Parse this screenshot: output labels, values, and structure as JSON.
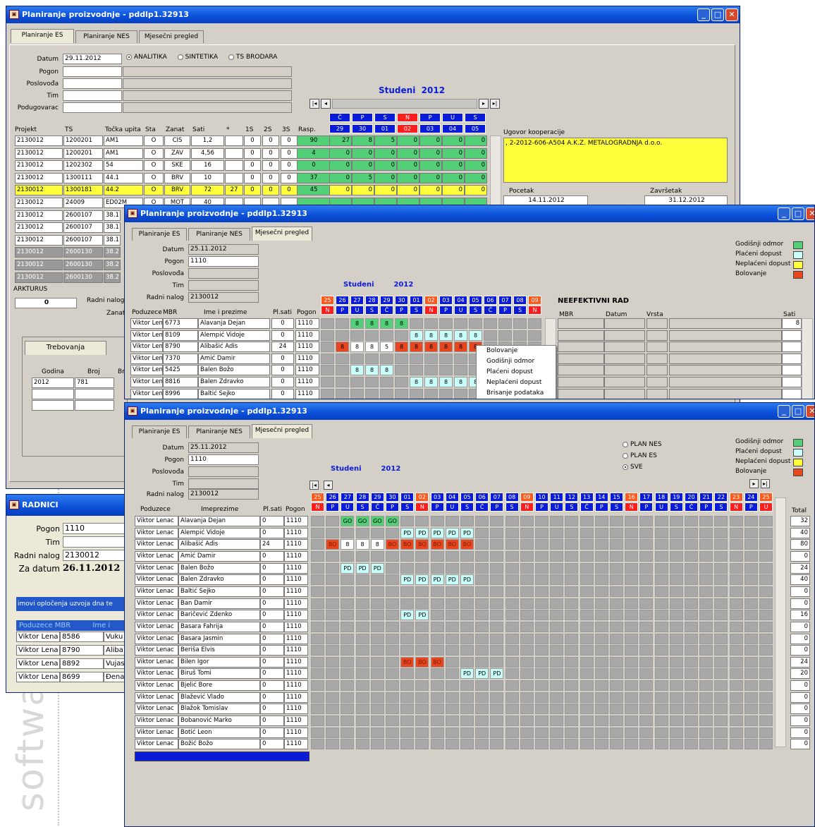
{
  "watermark": "softwa",
  "colors": {
    "title_blue": "#0a4fd6",
    "green": "#53cf78",
    "yellow": "#ffff3c",
    "red_bo": "#e8461f",
    "cyan_pd": "#c8fffb",
    "header_blue": "#0a1cd8",
    "header_red": "#ff1e1e",
    "header_orange": "#ff5a1e"
  },
  "win1": {
    "title": "Planiranje proizvodnje - pddlp1.32913",
    "tabs": [
      "Planiranje ES",
      "Planiranje NES",
      "Mjesečni pregled"
    ],
    "labels": {
      "datum": "Datum",
      "pogon": "Pogon",
      "poslovoda": "Poslovođa",
      "tim": "Tim",
      "podugovarac": "Podugovarac"
    },
    "datum_value": "29.11.2012",
    "radio": [
      "ANALITIKA",
      "SINTETIKA",
      "TS BRODARA"
    ],
    "month_title": "Studeni",
    "year": "2012",
    "day_letters": [
      "Č",
      "P",
      "S",
      "N",
      "P",
      "U",
      "S"
    ],
    "day_numbers": [
      "29",
      "30",
      "01",
      "02",
      "03",
      "04",
      "05"
    ],
    "col_headers": [
      "Projekt",
      "TS",
      "Točka upita",
      "Sta",
      "Zanat",
      "Sati",
      "*",
      "1S",
      "2S",
      "3S",
      "Rasp."
    ],
    "rows": [
      {
        "p": "2130012",
        "ts": "1200201",
        "tu": "AM1",
        "sta": "O",
        "z": "CIS",
        "s": "1,2",
        "st": "",
        "a": "0",
        "b": "0",
        "c": "0",
        "r": "90",
        "d": [
          "27",
          "8",
          "5",
          "0",
          "0",
          "0",
          "0"
        ]
      },
      {
        "p": "2130012",
        "ts": "1200201",
        "tu": "AM1",
        "sta": "O",
        "z": "ZAV",
        "s": "4,56",
        "st": "",
        "a": "0",
        "b": "0",
        "c": "0",
        "r": "4",
        "d": [
          "0",
          "0",
          "0",
          "0",
          "0",
          "0",
          "0"
        ]
      },
      {
        "p": "2130012",
        "ts": "1202302",
        "tu": "54",
        "sta": "O",
        "z": "SKE",
        "s": "16",
        "st": "",
        "a": "0",
        "b": "0",
        "c": "0",
        "r": "0",
        "d": [
          "0",
          "0",
          "0",
          "0",
          "0",
          "0",
          "0"
        ]
      },
      {
        "p": "2130012",
        "ts": "1300111",
        "tu": "44.1",
        "sta": "O",
        "z": "BRV",
        "s": "10",
        "st": "",
        "a": "0",
        "b": "0",
        "c": "0",
        "r": "37",
        "d": [
          "0",
          "5",
          "0",
          "0",
          "0",
          "0",
          "0"
        ]
      },
      {
        "p": "2130012",
        "ts": "1300181",
        "tu": "44.2",
        "sta": "O",
        "z": "BRV",
        "s": "72",
        "st": "27",
        "a": "0",
        "b": "0",
        "c": "0",
        "r": "45",
        "d": [
          "0",
          "0",
          "0",
          "0",
          "0",
          "0",
          "0"
        ]
      },
      {
        "p": "2130012",
        "ts": "24009",
        "tu": "ED02M",
        "sta": "O",
        "z": "MOT",
        "s": "40",
        "st": "",
        "a": "",
        "b": "",
        "c": "",
        "r": "",
        "d": [
          "",
          "",
          "",
          "",
          "",
          "",
          ""
        ]
      },
      {
        "p": "2130012",
        "ts": "2600107",
        "tu": "38.1",
        "sta": "",
        "z": "",
        "s": "",
        "st": "",
        "a": "",
        "b": "",
        "c": "",
        "r": "",
        "d": []
      },
      {
        "p": "2130012",
        "ts": "2600107",
        "tu": "38.1",
        "sta": "",
        "z": "",
        "s": "",
        "st": "",
        "a": "",
        "b": "",
        "c": "",
        "r": "",
        "d": []
      },
      {
        "p": "2130012",
        "ts": "2600107",
        "tu": "38.1",
        "sta": "",
        "z": "",
        "s": "",
        "st": "",
        "a": "",
        "b": "",
        "c": "",
        "r": "",
        "d": []
      },
      {
        "p": "2130012",
        "ts": "2600130",
        "tu": "38.2",
        "sta": "",
        "z": "",
        "s": "",
        "st": "",
        "a": "",
        "b": "",
        "c": "",
        "r": "",
        "d": []
      },
      {
        "p": "2130012",
        "ts": "2600130",
        "tu": "38.2",
        "sta": "",
        "z": "",
        "s": "",
        "st": "",
        "a": "",
        "b": "",
        "c": "",
        "r": "",
        "d": []
      },
      {
        "p": "2130012",
        "ts": "2600130",
        "tu": "38.2",
        "sta": "",
        "z": "",
        "s": "",
        "st": "",
        "a": "",
        "b": "",
        "c": "",
        "r": "",
        "d": []
      }
    ],
    "ugovor_label": "Ugovor kooperacije",
    "ugovor_text": ", 2-2012-606-A504 A.K.Z. METALOGRADNJA d.o.o.",
    "pocetak_label": "Pocetak",
    "pocetak": "14.11.2012",
    "zavrsetak_label": "Završetak",
    "zavrsetak": "31.12.2012",
    "arkturus": "ARKTURUS",
    "arkturus_val": "0",
    "radni_nalog": "Radni nalog",
    "zanat": "Zanat",
    "trebovanja": "Trebovanja",
    "godina": "Godina",
    "broj": "Broj",
    "br": "Br",
    "godina_val": "2012",
    "broj_val": "781"
  },
  "radnici": {
    "title": "RADNICI",
    "pogon_label": "Pogon",
    "pogon": "1110",
    "tim_label": "Tim",
    "radni_label": "Radni nalog",
    "radni": "2130012",
    "za_label": "Za datum",
    "za": "26.11.2012",
    "banner": "imovi opločenja uzvoja dna te",
    "headers": [
      "Poduzece",
      "MBR",
      "Ime i"
    ],
    "rows": [
      [
        "Viktor Lena",
        "8586",
        "Vuku"
      ],
      [
        "Viktor Lena",
        "8790",
        "Aliba"
      ],
      [
        "Viktor Lena",
        "8892",
        "Vujas"
      ],
      [
        "Viktor Lena",
        "8699",
        "Đena"
      ]
    ]
  },
  "win2": {
    "title": "Planiranje proizvodnje - pddlp1.32913",
    "tabs": [
      "Planiranje ES",
      "Planiranje NES",
      "Mjesečni pregled"
    ],
    "datum_label": "Datum",
    "datum": "25.11.2012",
    "pogon_label": "Pogon",
    "pogon": "1110",
    "poslovoda_label": "Poslovođa",
    "tim_label": "Tim",
    "radni_label": "Radni nalog",
    "radni": "2130012",
    "month": "Studeni",
    "year": "2012",
    "legend": [
      {
        "label": "Godišnji odmor",
        "color": "#53cf78"
      },
      {
        "label": "Plaćeni dopust",
        "color": "#c8fffb"
      },
      {
        "label": "Neplaćeni dopust",
        "color": "#ffff3c"
      },
      {
        "label": "Bolovanje",
        "color": "#e8461f"
      }
    ],
    "day_numbers": [
      "25",
      "26",
      "27",
      "28",
      "29",
      "30",
      "01",
      "02",
      "03",
      "04",
      "05",
      "06",
      "07",
      "08",
      "09"
    ],
    "day_letters": [
      "N",
      "P",
      "U",
      "S",
      "Č",
      "P",
      "S",
      "N",
      "P",
      "U",
      "S",
      "Č",
      "P",
      "S",
      "N"
    ],
    "headers": [
      "Poduzece",
      "MBR",
      "Ime i prezime",
      "Pl.sati",
      "Pogon"
    ],
    "rows": [
      {
        "pod": "Viktor Len",
        "mbr": "6773",
        "ime": "Alavanja Dejan",
        "pl": "0",
        "pog": "1110",
        "d": [
          "",
          "",
          "8",
          "8",
          "8",
          "8",
          "",
          "",
          "",
          "",
          "",
          "",
          "",
          "",
          ""
        ],
        "c": [
          "",
          "",
          "g",
          "g",
          "g",
          "g",
          "",
          "",
          "",
          "",
          "",
          "",
          "",
          "",
          ""
        ]
      },
      {
        "pod": "Viktor Len",
        "mbr": "8109",
        "ime": "Alempić Vidoje",
        "pl": "0",
        "pog": "1110",
        "d": [
          "",
          "",
          "",
          "",
          "",
          "",
          "8",
          "8",
          "8",
          "8",
          "8",
          "",
          "",
          "",
          ""
        ],
        "c": [
          "",
          "",
          "",
          "",
          "",
          "",
          "c",
          "c",
          "c",
          "c",
          "c",
          "",
          "",
          "",
          ""
        ]
      },
      {
        "pod": "Viktor Len",
        "mbr": "8790",
        "ime": "Alibašić Adis",
        "pl": "24",
        "pog": "1110",
        "d": [
          "",
          "8",
          "8",
          "8",
          "5",
          "8",
          "8",
          "8",
          "8",
          "8",
          "8",
          "",
          "",
          "",
          ""
        ],
        "c": [
          "",
          "r",
          "w",
          "w",
          "w",
          "r",
          "r",
          "r",
          "r",
          "r",
          "r",
          "",
          "",
          "",
          ""
        ]
      },
      {
        "pod": "Viktor Len",
        "mbr": "7370",
        "ime": "Amić Damir",
        "pl": "0",
        "pog": "1110",
        "d": [
          "",
          "",
          "",
          "",
          "",
          "",
          "",
          "",
          "",
          "",
          "",
          "",
          "",
          "",
          ""
        ],
        "c": [
          "",
          "",
          "",
          "",
          "",
          "",
          "",
          "",
          "",
          "",
          "",
          "",
          "",
          "",
          ""
        ]
      },
      {
        "pod": "Viktor Len",
        "mbr": "5425",
        "ime": "Balen Božo",
        "pl": "0",
        "pog": "1110",
        "d": [
          "",
          "",
          "8",
          "8",
          "8",
          "",
          "",
          "",
          "",
          "",
          "",
          "",
          "",
          "",
          ""
        ],
        "c": [
          "",
          "",
          "c",
          "c",
          "c",
          "",
          "",
          "",
          "",
          "",
          "",
          "",
          "",
          "",
          ""
        ]
      },
      {
        "pod": "Viktor Len",
        "mbr": "8816",
        "ime": "Balen Zdravko",
        "pl": "0",
        "pog": "1110",
        "d": [
          "",
          "",
          "",
          "",
          "",
          "",
          "8",
          "8",
          "8",
          "8",
          "8",
          "",
          "",
          "",
          ""
        ],
        "c": [
          "",
          "",
          "",
          "",
          "",
          "",
          "c",
          "c",
          "c",
          "c",
          "c",
          "",
          "",
          "",
          ""
        ]
      },
      {
        "pod": "Viktor Len",
        "mbr": "8996",
        "ime": "Baltić Sejko",
        "pl": "0",
        "pog": "1110",
        "d": [
          "",
          "",
          "",
          "",
          "",
          "",
          "",
          "",
          "",
          "",
          "",
          "",
          "",
          "",
          ""
        ],
        "c": [
          "",
          "",
          "",
          "",
          "",
          "",
          "",
          "",
          "",
          "",
          "",
          "",
          "",
          "",
          ""
        ]
      }
    ],
    "context_menu": [
      "Bolovanje",
      "Godišnji odmor",
      "Plaćeni dopust",
      "Neplaćeni dopust",
      "Brisanje podataka"
    ],
    "neef_title": "NEEFEKTIVNI RAD",
    "neef_headers": [
      "MBR",
      "Datum",
      "Vrsta",
      "Sati"
    ],
    "neef_first": "8"
  },
  "win3": {
    "title": "Planiranje proizvodnje - pddlp1.32913",
    "tabs": [
      "Planiranje ES",
      "Planiranje NES",
      "Mjesečni pregled"
    ],
    "datum_label": "Datum",
    "datum": "25.11.2012",
    "pogon_label": "Pogon",
    "pogon": "1110",
    "poslovoda_label": "Poslovođa",
    "tim_label": "Tim",
    "radni_label": "Radni nalog",
    "radni": "2130012",
    "month": "Studeni",
    "year": "2012",
    "plan_options": [
      "PLAN NES",
      "PLAN ES",
      "SVE"
    ],
    "legend": [
      {
        "label": "Godišnji odmor",
        "color": "#53cf78"
      },
      {
        "label": "Plaćeni dopust",
        "color": "#c8fffb"
      },
      {
        "label": "Neplaćeni dopust",
        "color": "#ffff3c"
      },
      {
        "label": "Bolovanje",
        "color": "#e8461f"
      }
    ],
    "day_numbers": [
      "25",
      "26",
      "27",
      "28",
      "29",
      "30",
      "01",
      "02",
      "03",
      "04",
      "05",
      "06",
      "07",
      "08",
      "09",
      "10",
      "11",
      "12",
      "13",
      "14",
      "15",
      "16",
      "17",
      "18",
      "19",
      "20",
      "21",
      "22",
      "23",
      "24",
      "25"
    ],
    "day_letters": [
      "N",
      "P",
      "U",
      "S",
      "Č",
      "P",
      "S",
      "N",
      "P",
      "U",
      "S",
      "Č",
      "P",
      "S",
      "N",
      "P",
      "U",
      "S",
      "Č",
      "P",
      "S",
      "N",
      "P",
      "U",
      "S",
      "Č",
      "P",
      "S",
      "N",
      "P",
      "U"
    ],
    "headers": [
      "Poduzece",
      "Imeprezime",
      "Pl.sati",
      "Pogon",
      "Total"
    ],
    "rows": [
      {
        "pod": "Viktor Lenac",
        "ime": "Alavanja Dejan",
        "pl": "0",
        "pog": "1110",
        "t": "32",
        "marks": [
          [
            2,
            "GO"
          ],
          [
            3,
            "GO"
          ],
          [
            4,
            "GO"
          ],
          [
            5,
            "GO"
          ]
        ]
      },
      {
        "pod": "Viktor Lenac",
        "ime": "Alempić Vidoje",
        "pl": "0",
        "pog": "1110",
        "t": "40",
        "marks": [
          [
            6,
            "PD"
          ],
          [
            7,
            "PD"
          ],
          [
            8,
            "PD"
          ],
          [
            9,
            "PD"
          ],
          [
            10,
            "PD"
          ]
        ]
      },
      {
        "pod": "Viktor Lenac",
        "ime": "Alibašić Adis",
        "pl": "24",
        "pog": "1110",
        "t": "80",
        "marks": [
          [
            1,
            "BO"
          ],
          [
            2,
            "8"
          ],
          [
            3,
            "8"
          ],
          [
            4,
            "8"
          ],
          [
            5,
            "BO"
          ],
          [
            6,
            "BO"
          ],
          [
            7,
            "BO"
          ],
          [
            8,
            "BO"
          ],
          [
            9,
            "BO"
          ],
          [
            10,
            "BO"
          ]
        ]
      },
      {
        "pod": "Viktor Lenac",
        "ime": "Amić Damir",
        "pl": "0",
        "pog": "1110",
        "t": "0",
        "marks": []
      },
      {
        "pod": "Viktor Lenac",
        "ime": "Balen Božo",
        "pl": "0",
        "pog": "1110",
        "t": "24",
        "marks": [
          [
            2,
            "PD"
          ],
          [
            3,
            "PD"
          ],
          [
            4,
            "PD"
          ]
        ]
      },
      {
        "pod": "Viktor Lenac",
        "ime": "Balen Zdravko",
        "pl": "0",
        "pog": "1110",
        "t": "40",
        "marks": [
          [
            6,
            "PD"
          ],
          [
            7,
            "PD"
          ],
          [
            8,
            "PD"
          ],
          [
            9,
            "PD"
          ],
          [
            10,
            "PD"
          ]
        ]
      },
      {
        "pod": "Viktor Lenac",
        "ime": "Baltić Sejko",
        "pl": "0",
        "pog": "1110",
        "t": "0",
        "marks": []
      },
      {
        "pod": "Viktor Lenac",
        "ime": "Ban Damir",
        "pl": "0",
        "pog": "1110",
        "t": "0",
        "marks": []
      },
      {
        "pod": "Viktor Lenac",
        "ime": "Baričević Zdenko",
        "pl": "0",
        "pog": "1110",
        "t": "16",
        "marks": [
          [
            6,
            "PD"
          ],
          [
            7,
            "PD"
          ]
        ]
      },
      {
        "pod": "Viktor Lenac",
        "ime": "Basara Fahrija",
        "pl": "0",
        "pog": "1110",
        "t": "0",
        "marks": []
      },
      {
        "pod": "Viktor Lenac",
        "ime": "Basara Jasmin",
        "pl": "0",
        "pog": "1110",
        "t": "0",
        "marks": []
      },
      {
        "pod": "Viktor Lenac",
        "ime": "Beriša Elvis",
        "pl": "0",
        "pog": "1110",
        "t": "0",
        "marks": []
      },
      {
        "pod": "Viktor Lenac",
        "ime": "Bilen Igor",
        "pl": "0",
        "pog": "1110",
        "t": "24",
        "marks": [
          [
            6,
            "BO"
          ],
          [
            7,
            "BO"
          ],
          [
            8,
            "BO"
          ]
        ]
      },
      {
        "pod": "Viktor Lenac",
        "ime": "Biruš Tomi",
        "pl": "0",
        "pog": "1110",
        "t": "20",
        "marks": [
          [
            10,
            "PD"
          ],
          [
            11,
            "PD"
          ],
          [
            12,
            "PD"
          ]
        ]
      },
      {
        "pod": "Viktor Lenac",
        "ime": "Bjelić Bore",
        "pl": "0",
        "pog": "1110",
        "t": "0",
        "marks": []
      },
      {
        "pod": "Viktor Lenac",
        "ime": "Blažević Vlado",
        "pl": "0",
        "pog": "1110",
        "t": "0",
        "marks": []
      },
      {
        "pod": "Viktor Lenac",
        "ime": "Blažok Tomislav",
        "pl": "0",
        "pog": "1110",
        "t": "0",
        "marks": []
      },
      {
        "pod": "Viktor Lenac",
        "ime": "Bobanović Marko",
        "pl": "0",
        "pog": "1110",
        "t": "0",
        "marks": []
      },
      {
        "pod": "Viktor Lenac",
        "ime": "Botić Leon",
        "pl": "0",
        "pog": "1110",
        "t": "0",
        "marks": []
      },
      {
        "pod": "Viktor Lenac",
        "ime": "Božić Božo",
        "pl": "0",
        "pog": "1110",
        "t": "0",
        "marks": []
      }
    ]
  }
}
